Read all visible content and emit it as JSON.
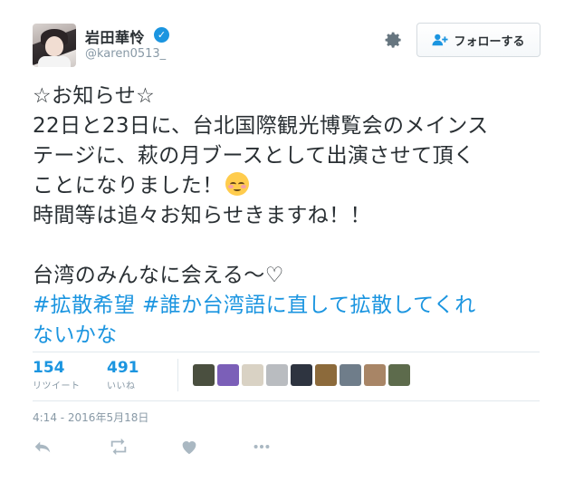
{
  "user": {
    "display_name": "岩田華怜",
    "handle": "@karen0513_",
    "verified": true
  },
  "follow_button": {
    "label": "フォローする"
  },
  "tweet": {
    "lines": [
      "☆お知らせ☆",
      "22日と23日に、台北国際観光博覧会のメインス",
      "テージに、萩の月ブースとして出演させて頂く",
      "ことになりました！",
      "時間等は追々お知らせきますね！！",
      "",
      "台湾のみんなに会える～♡"
    ],
    "hashtags": [
      "#拡散希望",
      "#誰か台湾語に直して拡散してくれ"
    ],
    "hashtag_continuation": "ないかな",
    "emoji": "relaxed-smiling-face"
  },
  "stats": {
    "retweets": {
      "count": "154",
      "label": "リツイート"
    },
    "likes": {
      "count": "491",
      "label": "いいね"
    }
  },
  "likers": [
    {
      "name": "liker-1",
      "color": "#4a4f3f"
    },
    {
      "name": "liker-2",
      "color": "#7b5fb8"
    },
    {
      "name": "liker-3",
      "color": "#d9d2c4"
    },
    {
      "name": "liker-4",
      "color": "#b9bcc0"
    },
    {
      "name": "liker-5",
      "color": "#2e3440"
    },
    {
      "name": "liker-6",
      "color": "#8c6a3b"
    },
    {
      "name": "liker-7",
      "color": "#6f7d8a"
    },
    {
      "name": "liker-8",
      "color": "#a88566"
    },
    {
      "name": "liker-9",
      "color": "#5d6b4c"
    }
  ],
  "timestamp": "4:14 - 2016年5月18日",
  "actions": [
    "reply-icon",
    "retweet-icon",
    "like-icon",
    "more-icon"
  ],
  "colors": {
    "accent": "#1b95e0",
    "text": "#292f33",
    "muted": "#8899a6",
    "border": "#e1e8ed"
  }
}
